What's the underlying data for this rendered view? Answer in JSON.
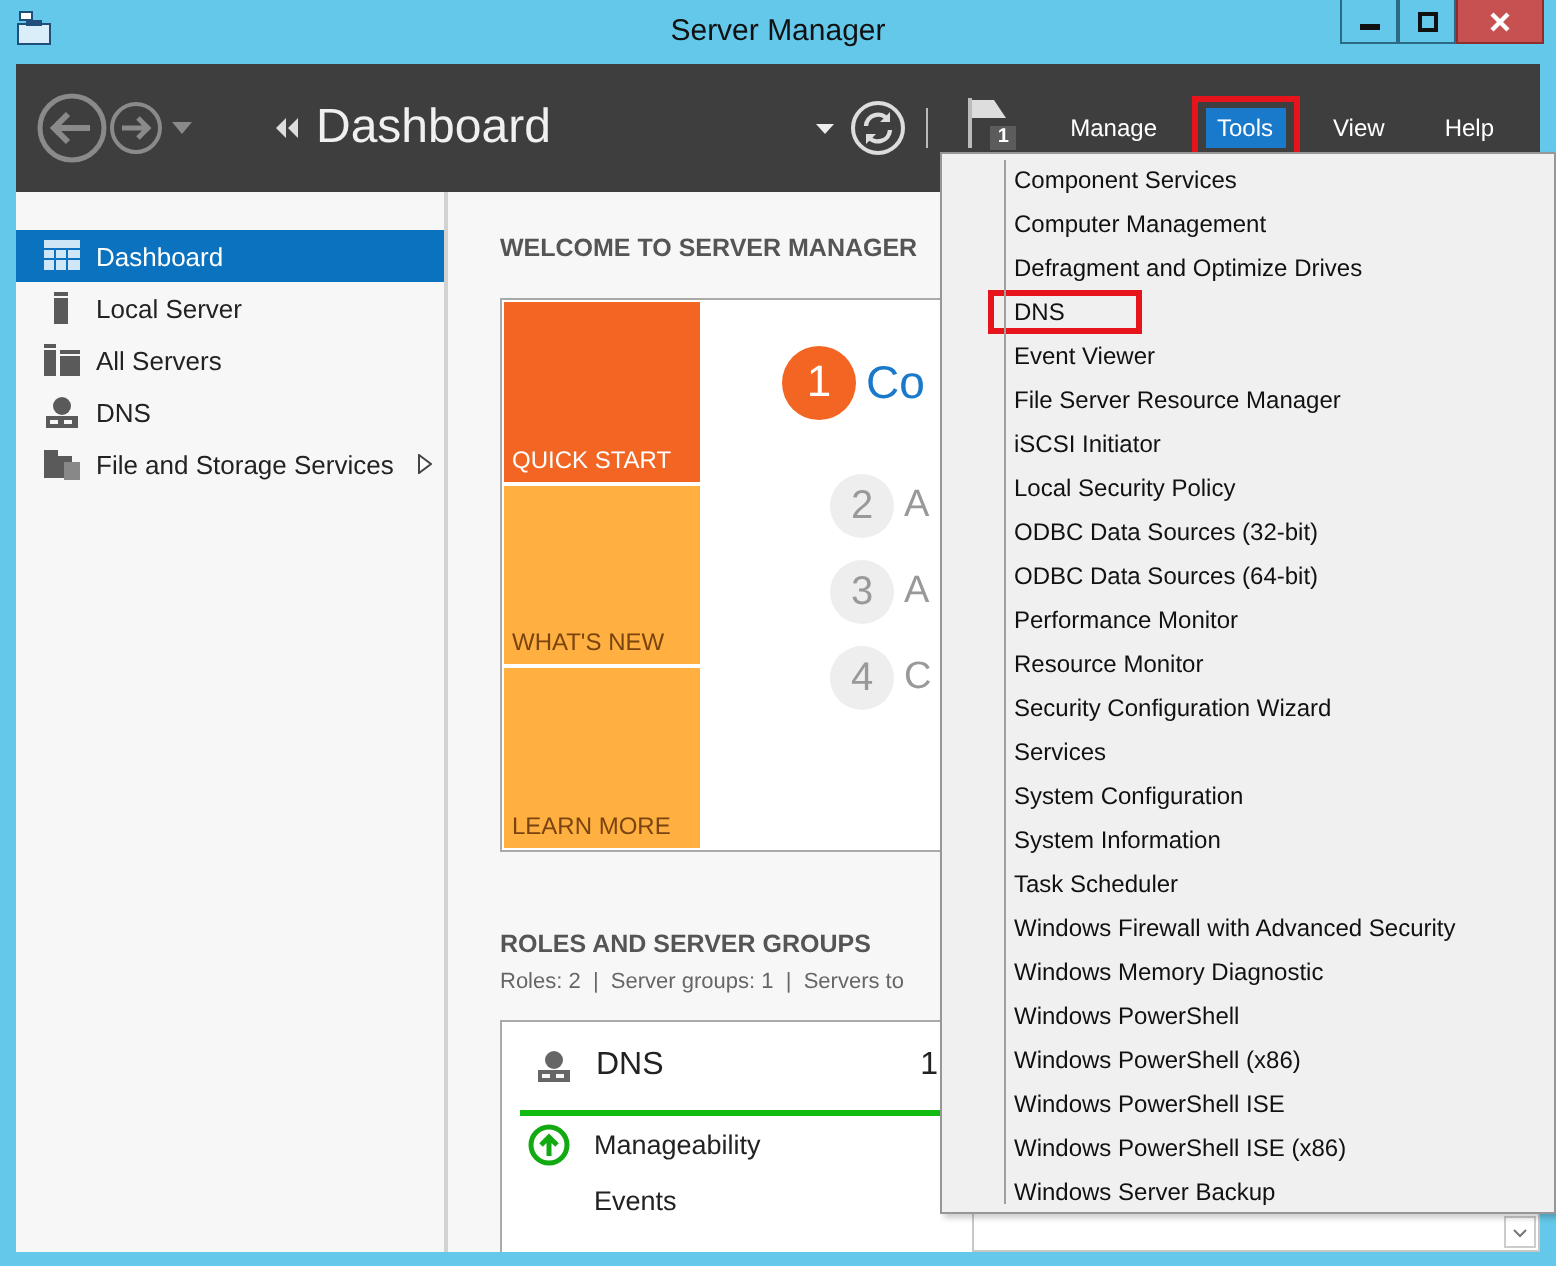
{
  "window": {
    "title": "Server Manager"
  },
  "header": {
    "breadcrumb": "Dashboard",
    "notification_count": "1",
    "menus": [
      {
        "label": "Manage",
        "selected": false,
        "highlighted": false
      },
      {
        "label": "Tools",
        "selected": true,
        "highlighted": true
      },
      {
        "label": "View",
        "selected": false,
        "highlighted": false
      },
      {
        "label": "Help",
        "selected": false,
        "highlighted": false
      }
    ]
  },
  "sidebar": {
    "items": [
      {
        "label": "Dashboard",
        "kind": "dashboard",
        "selected": true,
        "has_submenu": false
      },
      {
        "label": "Local Server",
        "kind": "server",
        "selected": false,
        "has_submenu": false
      },
      {
        "label": "All Servers",
        "kind": "servers",
        "selected": false,
        "has_submenu": false
      },
      {
        "label": "DNS",
        "kind": "dns",
        "selected": false,
        "has_submenu": false
      },
      {
        "label": "File and Storage Services",
        "kind": "files",
        "selected": false,
        "has_submenu": true
      }
    ]
  },
  "welcome": {
    "title": "WELCOME TO SERVER MANAGER",
    "tiles": [
      {
        "label": "QUICK START",
        "selected": true
      },
      {
        "label": "WHAT'S NEW",
        "selected": false
      },
      {
        "label": "LEARN MORE",
        "selected": false
      }
    ],
    "steps": [
      {
        "number": "1",
        "text": "Co",
        "selected": true
      },
      {
        "number": "2",
        "text": "A",
        "selected": false
      },
      {
        "number": "3",
        "text": "A",
        "selected": false
      },
      {
        "number": "4",
        "text": "C",
        "selected": false
      }
    ]
  },
  "roles": {
    "title": "ROLES AND SERVER GROUPS",
    "summary": "Roles: 2  |  Server groups: 1  |  Servers to",
    "tiles": [
      {
        "name": "DNS",
        "count": "1",
        "status_rows": [
          {
            "label": "Manageability",
            "ok": true
          },
          {
            "label": "Events",
            "ok": false
          }
        ]
      }
    ]
  },
  "tools_menu": {
    "items": [
      {
        "label": "Component Services",
        "highlighted": false
      },
      {
        "label": "Computer Management",
        "highlighted": false
      },
      {
        "label": "Defragment and Optimize Drives",
        "highlighted": false
      },
      {
        "label": "DNS",
        "highlighted": true
      },
      {
        "label": "Event Viewer",
        "highlighted": false
      },
      {
        "label": "File Server Resource Manager",
        "highlighted": false
      },
      {
        "label": "iSCSI Initiator",
        "highlighted": false
      },
      {
        "label": "Local Security Policy",
        "highlighted": false
      },
      {
        "label": "ODBC Data Sources (32-bit)",
        "highlighted": false
      },
      {
        "label": "ODBC Data Sources (64-bit)",
        "highlighted": false
      },
      {
        "label": "Performance Monitor",
        "highlighted": false
      },
      {
        "label": "Resource Monitor",
        "highlighted": false
      },
      {
        "label": "Security Configuration Wizard",
        "highlighted": false
      },
      {
        "label": "Services",
        "highlighted": false
      },
      {
        "label": "System Configuration",
        "highlighted": false
      },
      {
        "label": "System Information",
        "highlighted": false
      },
      {
        "label": "Task Scheduler",
        "highlighted": false
      },
      {
        "label": "Windows Firewall with Advanced Security",
        "highlighted": false
      },
      {
        "label": "Windows Memory Diagnostic",
        "highlighted": false
      },
      {
        "label": "Windows PowerShell",
        "highlighted": false
      },
      {
        "label": "Windows PowerShell (x86)",
        "highlighted": false
      },
      {
        "label": "Windows PowerShell ISE",
        "highlighted": false
      },
      {
        "label": "Windows PowerShell ISE (x86)",
        "highlighted": false
      },
      {
        "label": "Windows Server Backup",
        "highlighted": false
      }
    ]
  }
}
